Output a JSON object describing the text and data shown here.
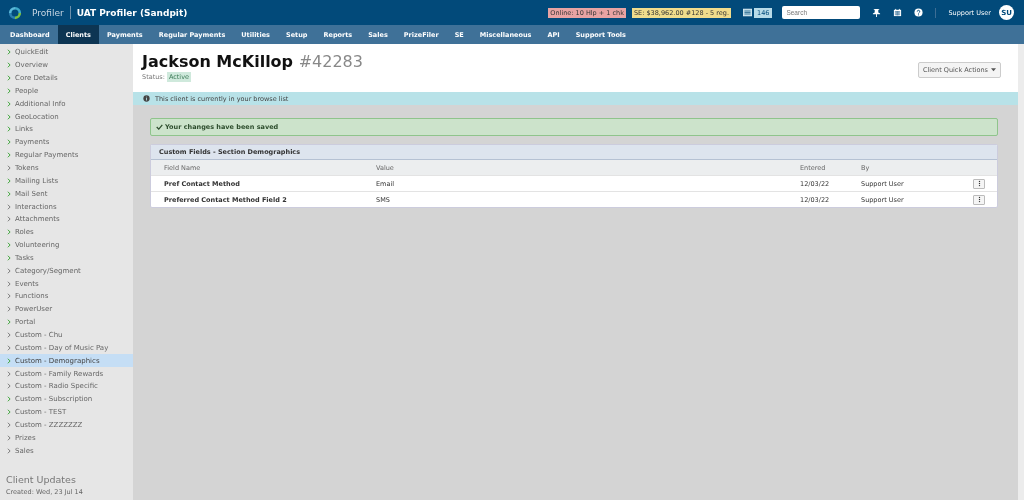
{
  "header": {
    "brand": "Profiler",
    "site": "UAT Profiler (Sandpit)",
    "badges": [
      {
        "text": "Online: 10 Hlp + 1 chk",
        "color": "#e8a3a3"
      },
      {
        "text": "SE: $38,962.00 #128 - 5 reg.",
        "color": "#f0dc8c"
      }
    ],
    "count": "146",
    "search": {
      "placeholder": "Search"
    },
    "user": "Support User",
    "initials": "SU"
  },
  "nav": [
    {
      "label": "Dashboard",
      "selected": false
    },
    {
      "label": "Clients",
      "selected": true
    },
    {
      "label": "Payments",
      "selected": false
    },
    {
      "label": "Regular Payments",
      "selected": false
    },
    {
      "label": "Utilities",
      "selected": false
    },
    {
      "label": "Setup",
      "selected": false
    },
    {
      "label": "Reports",
      "selected": false
    },
    {
      "label": "Sales",
      "selected": false
    },
    {
      "label": "PrizeFiler",
      "selected": false
    },
    {
      "label": "SE",
      "selected": false
    },
    {
      "label": "Miscellaneous",
      "selected": false
    },
    {
      "label": "API",
      "selected": false
    },
    {
      "label": "Support Tools",
      "selected": false
    }
  ],
  "sidebar": {
    "items": [
      {
        "label": "QuickEdit",
        "has_data": true,
        "selected": false
      },
      {
        "label": "Overview",
        "has_data": true,
        "selected": false
      },
      {
        "label": "Core Details",
        "has_data": true,
        "selected": false
      },
      {
        "label": "People",
        "has_data": true,
        "selected": false
      },
      {
        "label": "Additional Info",
        "has_data": true,
        "selected": false
      },
      {
        "label": "GeoLocation",
        "has_data": true,
        "selected": false
      },
      {
        "label": "Links",
        "has_data": true,
        "selected": false
      },
      {
        "label": "Payments",
        "has_data": true,
        "selected": false
      },
      {
        "label": "Regular Payments",
        "has_data": true,
        "selected": false
      },
      {
        "label": "Tokens",
        "has_data": false,
        "selected": false
      },
      {
        "label": "Mailing Lists",
        "has_data": true,
        "selected": false
      },
      {
        "label": "Mail Sent",
        "has_data": true,
        "selected": false
      },
      {
        "label": "Interactions",
        "has_data": false,
        "selected": false
      },
      {
        "label": "Attachments",
        "has_data": false,
        "selected": false
      },
      {
        "label": "Roles",
        "has_data": true,
        "selected": false
      },
      {
        "label": "Volunteering",
        "has_data": true,
        "selected": false
      },
      {
        "label": "Tasks",
        "has_data": true,
        "selected": false
      },
      {
        "label": "Category/Segment",
        "has_data": false,
        "selected": false
      },
      {
        "label": "Events",
        "has_data": false,
        "selected": false
      },
      {
        "label": "Functions",
        "has_data": false,
        "selected": false
      },
      {
        "label": "PowerUser",
        "has_data": false,
        "selected": false
      },
      {
        "label": "Portal",
        "has_data": true,
        "selected": false
      },
      {
        "label": "Custom - Chu",
        "has_data": false,
        "selected": false
      },
      {
        "label": "Custom - Day of Music Pay",
        "has_data": false,
        "selected": false
      },
      {
        "label": "Custom - Demographics",
        "has_data": true,
        "selected": true
      },
      {
        "label": "Custom - Family Rewards",
        "has_data": false,
        "selected": false
      },
      {
        "label": "Custom - Radio Specific",
        "has_data": false,
        "selected": false
      },
      {
        "label": "Custom - Subscription",
        "has_data": true,
        "selected": false
      },
      {
        "label": "Custom - TEST",
        "has_data": true,
        "selected": false
      },
      {
        "label": "Custom - ZZZZZZZ",
        "has_data": false,
        "selected": false
      },
      {
        "label": "Prizes",
        "has_data": false,
        "selected": false
      },
      {
        "label": "Sales",
        "has_data": false,
        "selected": false
      }
    ],
    "updates_title": "Client Updates",
    "created": "Created: Wed, 23 Jul 14"
  },
  "client": {
    "name": "Jackson McKillop",
    "number": "#42283",
    "status_label": "Status:",
    "status": "Active",
    "actions_button": "Client Quick Actions"
  },
  "info_bar": "This client is currently in your browse list",
  "success": "Your changes have been saved",
  "panel": {
    "title": "Custom Fields - Section Demographics",
    "columns": [
      "Field Name",
      "Value",
      "Entered",
      "By"
    ],
    "rows": [
      {
        "field": "Pref Contact Method",
        "value": "Email",
        "entered": "12/03/22",
        "by": "Support User"
      },
      {
        "field": "Preferred Contact Method Field 2",
        "value": "SMS",
        "entered": "12/03/22",
        "by": "Support User"
      }
    ]
  }
}
